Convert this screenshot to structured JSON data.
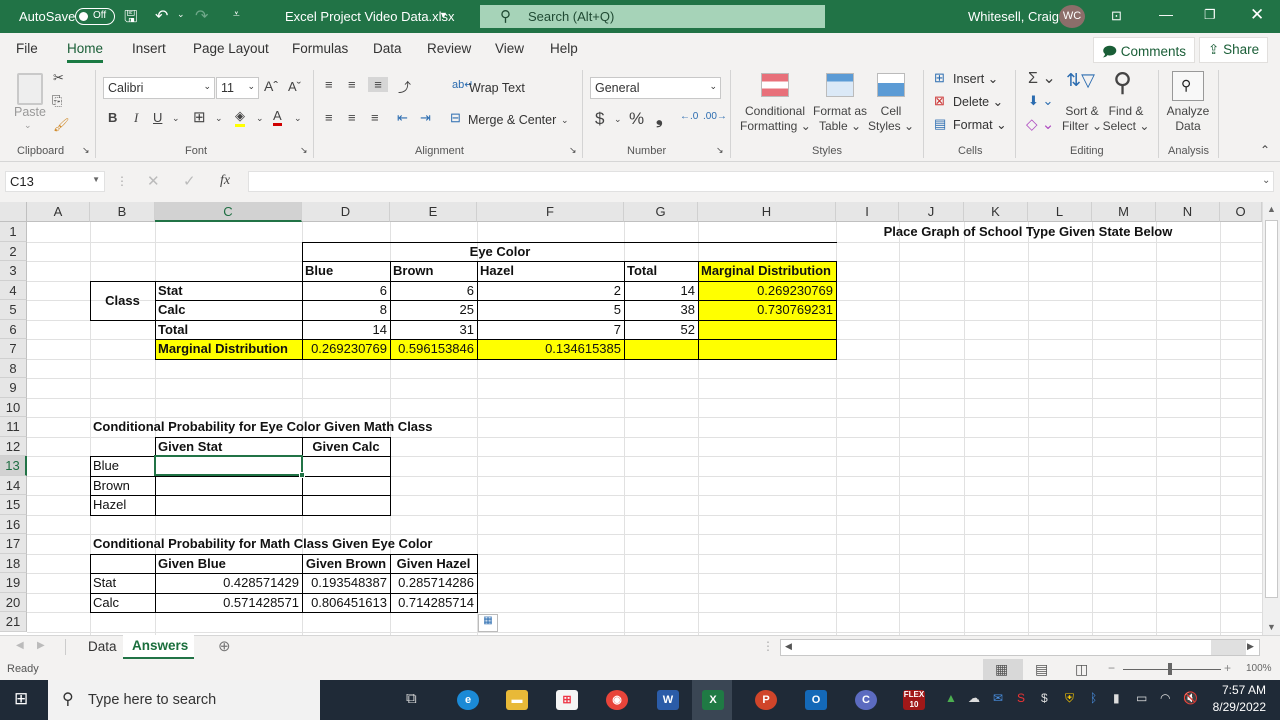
{
  "titlebar": {
    "autosave_label": "AutoSave",
    "autosave_state": "Off",
    "filename": "Excel Project Video Data.xlsx",
    "search_placeholder": "Search (Alt+Q)",
    "user_name": "Whitesell, Craig",
    "user_initials": "WC"
  },
  "menu": {
    "tabs": [
      "File",
      "Home",
      "Insert",
      "Page Layout",
      "Formulas",
      "Data",
      "Review",
      "View",
      "Help"
    ],
    "active": "Home",
    "comments_label": "Comments",
    "share_label": "Share"
  },
  "ribbon": {
    "clipboard": {
      "paste": "Paste",
      "label": "Clipboard"
    },
    "font": {
      "name": "Calibri",
      "size": "11",
      "bold": "B",
      "italic": "I",
      "underline": "U",
      "label": "Font"
    },
    "alignment": {
      "wrap_text": "Wrap Text",
      "merge_center": "Merge & Center",
      "label": "Alignment"
    },
    "number": {
      "format": "General",
      "currency": "$",
      "percent": "%",
      "comma": "❟",
      "label": "Number"
    },
    "styles": {
      "conditional_1": "Conditional",
      "conditional_2": "Formatting",
      "format_table_1": "Format as",
      "format_table_2": "Table",
      "cell_styles_1": "Cell",
      "cell_styles_2": "Styles",
      "label": "Styles"
    },
    "cells": {
      "insert": "Insert",
      "delete": "Delete",
      "format": "Format",
      "label": "Cells"
    },
    "editing": {
      "sort_1": "Sort &",
      "sort_2": "Filter",
      "find_1": "Find &",
      "find_2": "Select",
      "label": "Editing"
    },
    "analysis": {
      "analyze_1": "Analyze",
      "analyze_2": "Data",
      "label": "Analysis"
    }
  },
  "formula_bar": {
    "name_box": "C13",
    "fx": "fx",
    "value": ""
  },
  "columns": [
    "A",
    "B",
    "C",
    "D",
    "E",
    "F",
    "G",
    "H",
    "I",
    "J",
    "K",
    "L",
    "M",
    "N",
    "O"
  ],
  "selected_column": "C",
  "rows": [
    "1",
    "2",
    "3",
    "4",
    "5",
    "6",
    "7",
    "8",
    "9",
    "10",
    "11",
    "12",
    "13",
    "14",
    "15",
    "16",
    "17",
    "18",
    "19",
    "20",
    "21"
  ],
  "selected_row": "13",
  "sheet": {
    "graph_note": "Place Graph of School Type Given State Below",
    "eye_color_header": "Eye Color",
    "class_label": "Class",
    "contingency": {
      "headers": [
        "Blue",
        "Brown",
        "Hazel",
        "Total",
        "Marginal Distribution"
      ],
      "rows": [
        {
          "label": "Stat",
          "values": [
            "6",
            "6",
            "2",
            "14",
            "0.269230769"
          ]
        },
        {
          "label": "Calc",
          "values": [
            "8",
            "25",
            "5",
            "38",
            "0.730769231"
          ]
        },
        {
          "label": "Total",
          "values": [
            "14",
            "31",
            "7",
            "52",
            ""
          ]
        },
        {
          "label": "Marginal Distribution",
          "values": [
            "0.269230769",
            "0.596153846",
            "0.134615385",
            "",
            ""
          ]
        }
      ]
    },
    "cond_eye_given_class": {
      "title": "Conditional Probability for Eye Color Given Math Class",
      "headers": [
        "Given Stat",
        "Given Calc"
      ],
      "rows": [
        {
          "label": "Blue",
          "values": [
            "",
            ""
          ]
        },
        {
          "label": "Brown",
          "values": [
            "",
            ""
          ]
        },
        {
          "label": "Hazel",
          "values": [
            "",
            ""
          ]
        }
      ]
    },
    "cond_class_given_eye": {
      "title": "Conditional Probability for Math Class Given Eye Color",
      "headers": [
        "Given Blue",
        "Given Brown",
        "Given Hazel"
      ],
      "rows": [
        {
          "label": "Stat",
          "values": [
            "0.428571429",
            "0.193548387",
            "0.285714286"
          ]
        },
        {
          "label": "Calc",
          "values": [
            "0.571428571",
            "0.806451613",
            "0.714285714"
          ]
        }
      ]
    }
  },
  "sheet_tabs": {
    "tabs": [
      "Data",
      "Answers"
    ],
    "active": "Answers"
  },
  "status": {
    "ready": "Ready",
    "zoom": "100%"
  },
  "taskbar": {
    "search_placeholder": "Type here to search",
    "time": "7:57 AM",
    "date": "8/29/2022"
  },
  "colors": {
    "excel_green": "#217346",
    "highlight_yellow": "#ffff00"
  }
}
